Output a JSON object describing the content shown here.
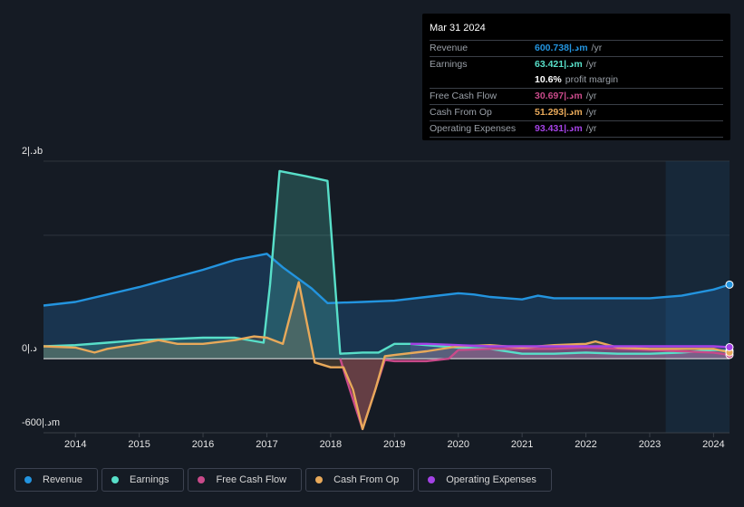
{
  "tooltip": {
    "date": "Mar 31 2024",
    "rows": [
      {
        "label": "Revenue",
        "value": "600.738|.دm",
        "unit": "/yr",
        "color": "#2394df"
      },
      {
        "label": "Earnings",
        "value": "63.421|.دm",
        "unit": "/yr",
        "color": "#58dfc9"
      },
      {
        "label": "",
        "value": "10.6%",
        "unit": "profit margin",
        "color": "#ffffff"
      },
      {
        "label": "Free Cash Flow",
        "value": "30.697|.دm",
        "unit": "/yr",
        "color": "#c94a8a"
      },
      {
        "label": "Cash From Op",
        "value": "51.293|.دm",
        "unit": "/yr",
        "color": "#e8a95a"
      },
      {
        "label": "Operating Expenses",
        "value": "93.431|.دm",
        "unit": "/yr",
        "color": "#a442e5"
      }
    ]
  },
  "legend": [
    {
      "label": "Revenue",
      "color": "#2394df"
    },
    {
      "label": "Earnings",
      "color": "#58dfc9"
    },
    {
      "label": "Free Cash Flow",
      "color": "#c94a8a"
    },
    {
      "label": "Cash From Op",
      "color": "#e8a95a"
    },
    {
      "label": "Operating Expenses",
      "color": "#a442e5"
    }
  ],
  "chart_data": {
    "type": "area",
    "title": "",
    "xlabel": "",
    "ylabel": "",
    "unit": "billions",
    "x_ticks": [
      "2014",
      "2015",
      "2016",
      "2017",
      "2018",
      "2019",
      "2020",
      "2021",
      "2022",
      "2023",
      "2024"
    ],
    "y_tick_labels": [
      {
        "label": "2|.دb",
        "value": 1.6
      },
      {
        "label": "0|.د",
        "value": 0
      },
      {
        "label": "-600|.دm",
        "value": -0.6
      }
    ],
    "xlim": [
      2013.5,
      2024.25
    ],
    "ylim": [
      -0.6,
      1.6
    ],
    "highlight_range": [
      2023.25,
      2024.25
    ],
    "grid": true,
    "legend_position": "bottom",
    "series": [
      {
        "name": "Revenue",
        "color": "#2394df",
        "x": [
          2013.5,
          2014.0,
          2014.5,
          2015.0,
          2015.5,
          2016.0,
          2016.5,
          2017.0,
          2017.25,
          2017.7,
          2017.95,
          2018.5,
          2019.0,
          2019.5,
          2020.0,
          2020.25,
          2020.5,
          2021.0,
          2021.25,
          2021.5,
          2022.0,
          2022.5,
          2023.0,
          2023.5,
          2024.0,
          2024.25
        ],
        "values": [
          0.43,
          0.46,
          0.52,
          0.58,
          0.65,
          0.72,
          0.8,
          0.85,
          0.74,
          0.57,
          0.45,
          0.46,
          0.47,
          0.5,
          0.53,
          0.52,
          0.5,
          0.48,
          0.51,
          0.49,
          0.49,
          0.49,
          0.49,
          0.51,
          0.56,
          0.6
        ]
      },
      {
        "name": "Earnings",
        "color": "#58dfc9",
        "x": [
          2013.5,
          2014.0,
          2014.5,
          2015.0,
          2015.5,
          2016.0,
          2016.5,
          2016.95,
          2017.05,
          2017.2,
          2017.6,
          2017.95,
          2018.15,
          2018.5,
          2018.75,
          2019.0,
          2019.25,
          2019.5,
          2020.0,
          2020.5,
          2021.0,
          2021.5,
          2022.0,
          2022.5,
          2023.0,
          2023.5,
          2024.0,
          2024.25
        ],
        "values": [
          0.1,
          0.11,
          0.13,
          0.15,
          0.16,
          0.17,
          0.17,
          0.13,
          0.6,
          1.52,
          1.48,
          1.44,
          0.04,
          0.05,
          0.05,
          0.12,
          0.12,
          0.11,
          0.09,
          0.08,
          0.04,
          0.04,
          0.05,
          0.04,
          0.04,
          0.05,
          0.07,
          0.063
        ]
      },
      {
        "name": "Free Cash Flow",
        "color": "#c94a8a",
        "x": [
          2018.15,
          2018.3,
          2018.5,
          2018.7,
          2018.85,
          2019.0,
          2019.5,
          2019.85,
          2020.0,
          2020.5,
          2021.0,
          2021.5,
          2022.0,
          2022.5,
          2023.0,
          2023.5,
          2024.0,
          2024.25
        ],
        "values": [
          0.0,
          -0.25,
          -0.57,
          -0.25,
          -0.01,
          -0.02,
          -0.02,
          0.0,
          0.07,
          0.08,
          0.08,
          0.08,
          0.09,
          0.08,
          0.07,
          0.06,
          0.05,
          0.031
        ]
      },
      {
        "name": "Cash From Op",
        "color": "#e8a95a",
        "x": [
          2013.5,
          2014.0,
          2014.3,
          2014.5,
          2015.0,
          2015.3,
          2015.6,
          2016.0,
          2016.5,
          2016.8,
          2017.0,
          2017.25,
          2017.5,
          2017.75,
          2018.0,
          2018.2,
          2018.35,
          2018.5,
          2018.7,
          2018.85,
          2019.0,
          2019.5,
          2020.0,
          2020.5,
          2021.0,
          2021.5,
          2022.0,
          2022.15,
          2022.5,
          2023.0,
          2023.5,
          2024.0,
          2024.25
        ],
        "values": [
          0.1,
          0.09,
          0.05,
          0.08,
          0.12,
          0.15,
          0.12,
          0.12,
          0.15,
          0.18,
          0.17,
          0.12,
          0.62,
          -0.03,
          -0.07,
          -0.07,
          -0.25,
          -0.57,
          -0.25,
          0.02,
          0.03,
          0.06,
          0.1,
          0.11,
          0.09,
          0.11,
          0.12,
          0.14,
          0.09,
          0.08,
          0.08,
          0.08,
          0.051
        ]
      },
      {
        "name": "Operating Expenses",
        "color": "#a442e5",
        "x": [
          2019.25,
          2019.5,
          2020.0,
          2020.5,
          2021.0,
          2021.5,
          2022.0,
          2022.5,
          2023.0,
          2023.5,
          2024.0,
          2024.25
        ],
        "values": [
          0.12,
          0.12,
          0.11,
          0.1,
          0.1,
          0.1,
          0.1,
          0.1,
          0.1,
          0.1,
          0.1,
          0.093
        ]
      }
    ]
  }
}
